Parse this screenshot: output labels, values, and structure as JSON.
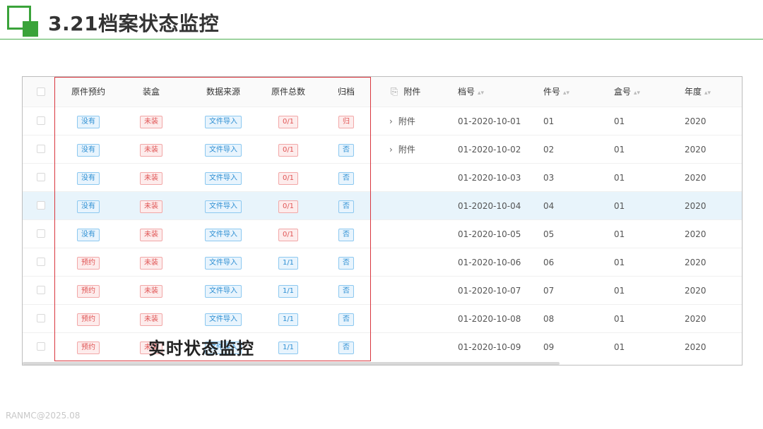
{
  "header": {
    "title": "3.21档案状态监控",
    "accent_color": "#3aa33a"
  },
  "table": {
    "columns": {
      "original_booking": "原件预约",
      "packed": "装盒",
      "data_source": "数据来源",
      "original_total": "原件总数",
      "archived": "归档",
      "attachment": "附件",
      "archive_no": "档号",
      "item_no": "件号",
      "box_no": "盒号",
      "year": "年度"
    },
    "rows": [
      {
        "booking": "没有",
        "booking_color": "blue",
        "packed": "未装",
        "source": "文件导入",
        "total": "0/1",
        "total_color": "red",
        "archived": "归",
        "archived_color": "red",
        "attachment": "附件",
        "archive_no": "01-2020-10-01",
        "item_no": "01",
        "box_no": "01",
        "year": "2020",
        "highlight": false
      },
      {
        "booking": "没有",
        "booking_color": "blue",
        "packed": "未装",
        "source": "文件导入",
        "total": "0/1",
        "total_color": "red",
        "archived": "否",
        "archived_color": "blue",
        "attachment": "附件",
        "archive_no": "01-2020-10-02",
        "item_no": "02",
        "box_no": "01",
        "year": "2020",
        "highlight": false
      },
      {
        "booking": "没有",
        "booking_color": "blue",
        "packed": "未装",
        "source": "文件导入",
        "total": "0/1",
        "total_color": "red",
        "archived": "否",
        "archived_color": "blue",
        "attachment": "",
        "archive_no": "01-2020-10-03",
        "item_no": "03",
        "box_no": "01",
        "year": "2020",
        "highlight": false
      },
      {
        "booking": "没有",
        "booking_color": "blue",
        "packed": "未装",
        "source": "文件导入",
        "total": "0/1",
        "total_color": "red",
        "archived": "否",
        "archived_color": "blue",
        "attachment": "",
        "archive_no": "01-2020-10-04",
        "item_no": "04",
        "box_no": "01",
        "year": "2020",
        "highlight": true
      },
      {
        "booking": "没有",
        "booking_color": "blue",
        "packed": "未装",
        "source": "文件导入",
        "total": "0/1",
        "total_color": "red",
        "archived": "否",
        "archived_color": "blue",
        "attachment": "",
        "archive_no": "01-2020-10-05",
        "item_no": "05",
        "box_no": "01",
        "year": "2020",
        "highlight": false
      },
      {
        "booking": "预约",
        "booking_color": "red",
        "packed": "未装",
        "source": "文件导入",
        "total": "1/1",
        "total_color": "blue",
        "archived": "否",
        "archived_color": "blue",
        "attachment": "",
        "archive_no": "01-2020-10-06",
        "item_no": "06",
        "box_no": "01",
        "year": "2020",
        "highlight": false
      },
      {
        "booking": "预约",
        "booking_color": "red",
        "packed": "未装",
        "source": "文件导入",
        "total": "1/1",
        "total_color": "blue",
        "archived": "否",
        "archived_color": "blue",
        "attachment": "",
        "archive_no": "01-2020-10-07",
        "item_no": "07",
        "box_no": "01",
        "year": "2020",
        "highlight": false
      },
      {
        "booking": "预约",
        "booking_color": "red",
        "packed": "未装",
        "source": "文件导入",
        "total": "1/1",
        "total_color": "blue",
        "archived": "否",
        "archived_color": "blue",
        "attachment": "",
        "archive_no": "01-2020-10-08",
        "item_no": "08",
        "box_no": "01",
        "year": "2020",
        "highlight": false
      },
      {
        "booking": "预约",
        "booking_color": "red",
        "packed": "未装",
        "source": "文件导入",
        "total": "1/1",
        "total_color": "blue",
        "archived": "否",
        "archived_color": "blue",
        "attachment": "",
        "archive_no": "01-2020-10-09",
        "item_no": "09",
        "box_no": "01",
        "year": "2020",
        "highlight": false
      }
    ]
  },
  "annotation": {
    "label": "实时状态监控",
    "box_color": "#d9363e"
  },
  "footer": {
    "text": "RANMC@2025.08"
  },
  "icons": {
    "sort": "sort-icon",
    "attachment": "paperclip-icon",
    "expand": "chevron-right-icon"
  }
}
